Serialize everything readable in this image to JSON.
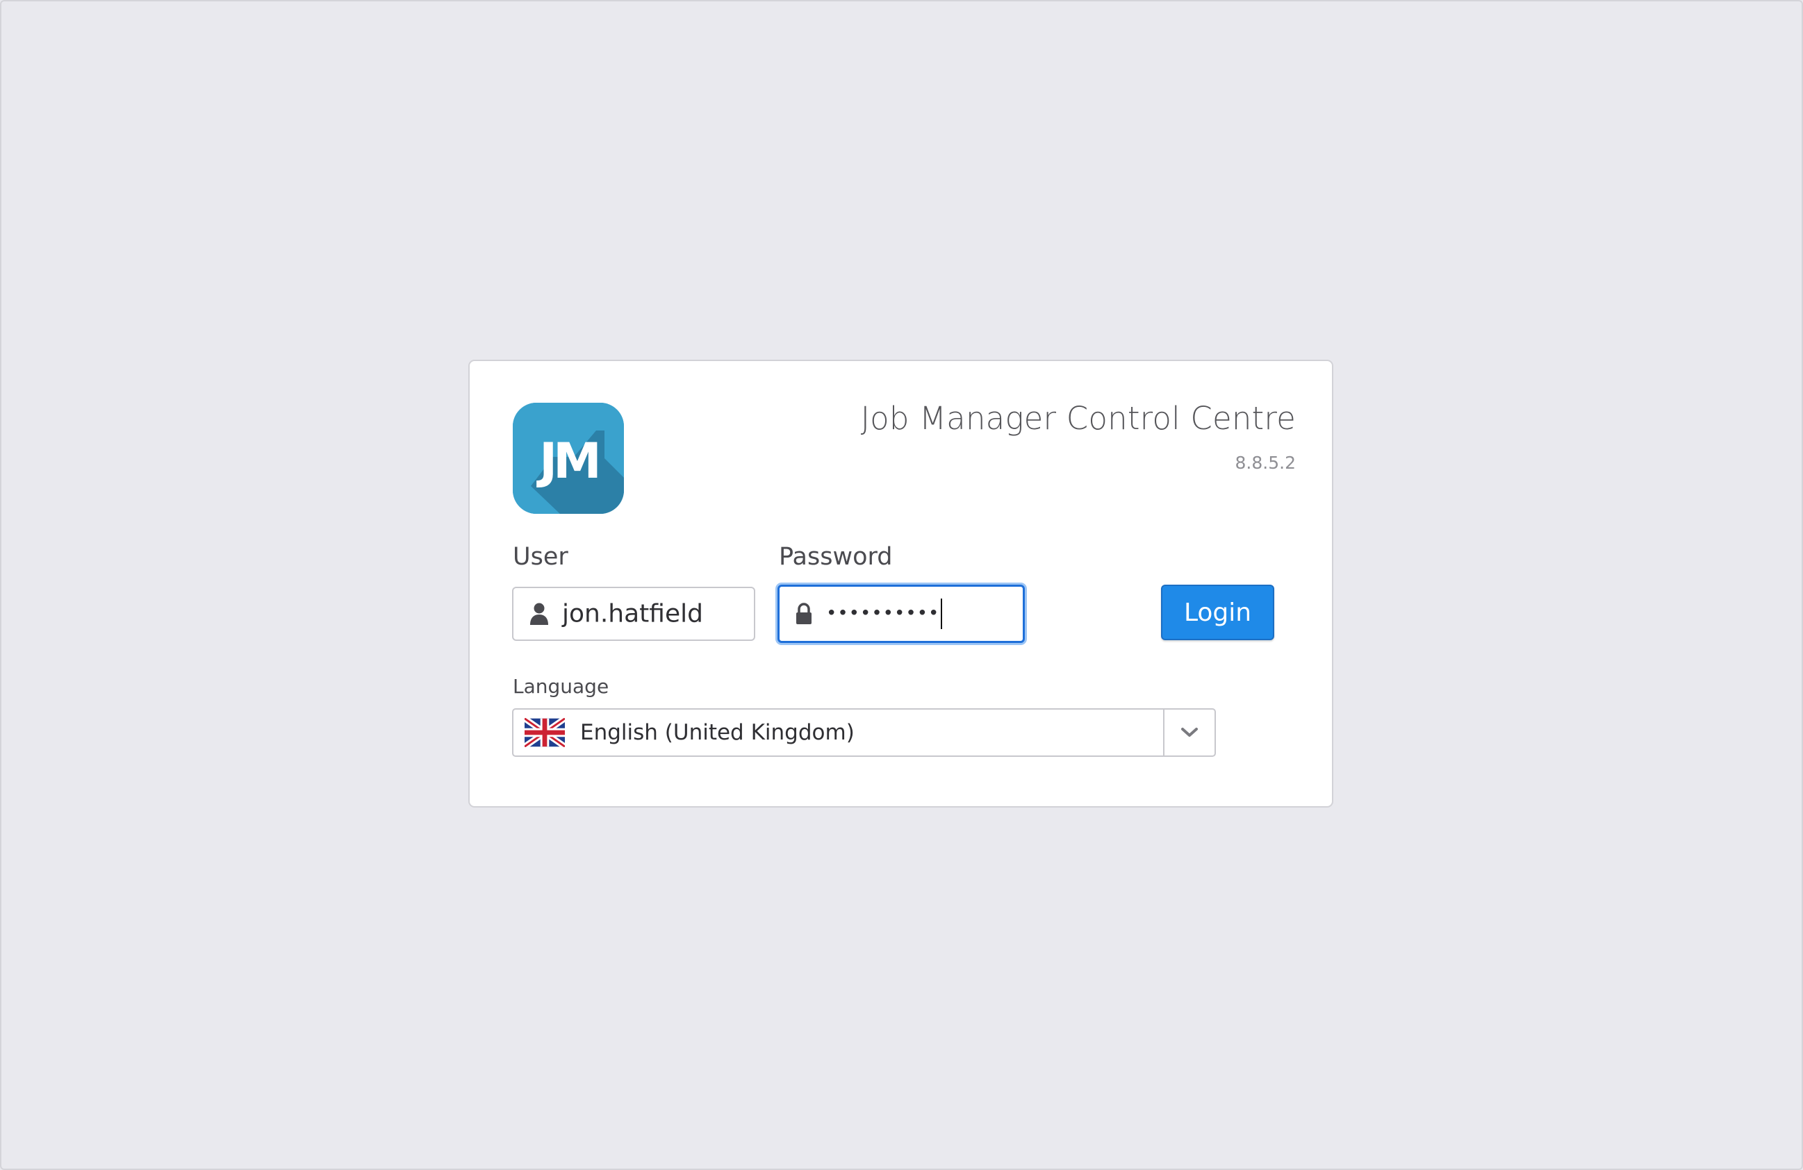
{
  "app": {
    "title": "Job Manager Control Centre",
    "version": "8.8.5.2",
    "logo_text": "JM",
    "logo_color": "#3aa2cd",
    "logo_shadow_color": "#2a7aa0"
  },
  "login_form": {
    "user_label": "User",
    "user_value": "jon.hatfield",
    "user_icon": "user-icon",
    "password_label": "Password",
    "password_masked": "••••••••••",
    "password_icon": "lock-icon",
    "login_button_label": "Login",
    "accent_color": "#1f8ae8",
    "focus_color": "#1e6fd9"
  },
  "language": {
    "label": "Language",
    "selected": "English (United Kingdom)",
    "flag_icon": "uk-flag-icon",
    "toggle_icon": "chevron-down-icon"
  }
}
